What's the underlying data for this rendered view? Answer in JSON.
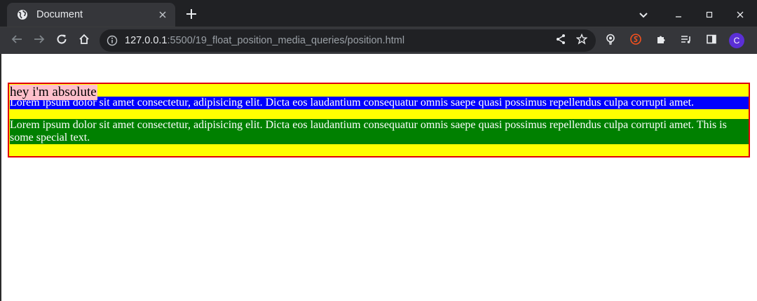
{
  "browser": {
    "tab": {
      "title": "Document"
    },
    "address_bar": {
      "host": "127.0.0.1",
      "path": ":5500/19_float_position_media_queries/position.html"
    },
    "profile_initial": "C",
    "icons": {
      "tab_favicon": "globe-icon",
      "tab_close": "close-icon",
      "new_tab": "plus-icon",
      "tab_search": "chevron-down-icon",
      "minimize": "minimize-icon",
      "maximize": "maximize-icon",
      "close_window": "close-icon",
      "back": "arrow-left-icon",
      "forward": "arrow-right-icon",
      "reload": "reload-icon",
      "home": "home-icon",
      "site_info": "info-icon",
      "share": "share-icon",
      "bookmark": "star-icon",
      "extensions": [
        "lightbulb-icon",
        "svelte-icon",
        "puzzle-icon",
        "media-queue-icon",
        "side-panel-icon"
      ],
      "menu": "kebab-menu-icon"
    },
    "colors": {
      "frame": "#202124",
      "toolbar": "#35363a",
      "avatar": "#5b2fd6"
    }
  },
  "page": {
    "absolute_text": "hey i'm absolute",
    "paragraph_1": "Lorem ipsum dolor sit amet consectetur, adipisicing elit. Dicta eos laudantium consequatur omnis saepe quasi possimus repellendus culpa corrupti amet.",
    "paragraph_2": "Lorem ipsum dolor sit amet consectetur, adipisicing elit. Dicta eos laudantium consequatur omnis saepe quasi possimus repellendus culpa corrupti amet. This is some special text.",
    "colors": {
      "container_border": "#e00000",
      "container_bg": "#ffff00",
      "absolute_bg": "#ffc0cb",
      "paragraph_1_bg": "#0000ff",
      "paragraph_2_bg": "#008000"
    }
  }
}
